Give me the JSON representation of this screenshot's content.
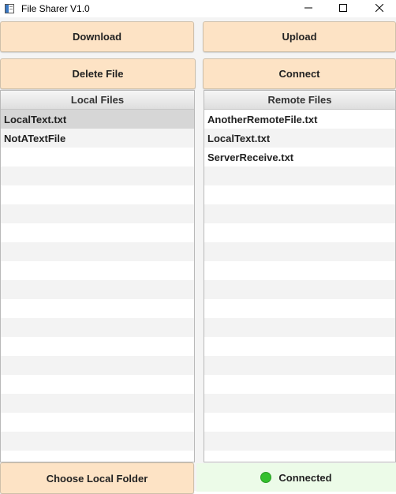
{
  "window": {
    "title": "File Sharer V1.0",
    "controls": [
      "minimize-icon",
      "maximize-icon",
      "close-icon"
    ]
  },
  "toolbar": {
    "download_label": "Download",
    "upload_label": "Upload",
    "delete_label": "Delete File",
    "connect_label": "Connect"
  },
  "local_files": {
    "header": "Local Files",
    "items": [
      "LocalText.txt",
      "NotATextFile"
    ],
    "selected": "LocalText.txt"
  },
  "remote_files": {
    "header": "Remote Files",
    "items": [
      "AnotherRemoteFile.txt",
      "LocalText.txt",
      "ServerReceive.txt"
    ]
  },
  "footer": {
    "choose_folder_label": "Choose Local Folder",
    "status_text": "Connected",
    "status_color": "#34c02e"
  },
  "colors": {
    "button_bg": "#fde3c5",
    "status_bg": "#ecfbe8"
  }
}
